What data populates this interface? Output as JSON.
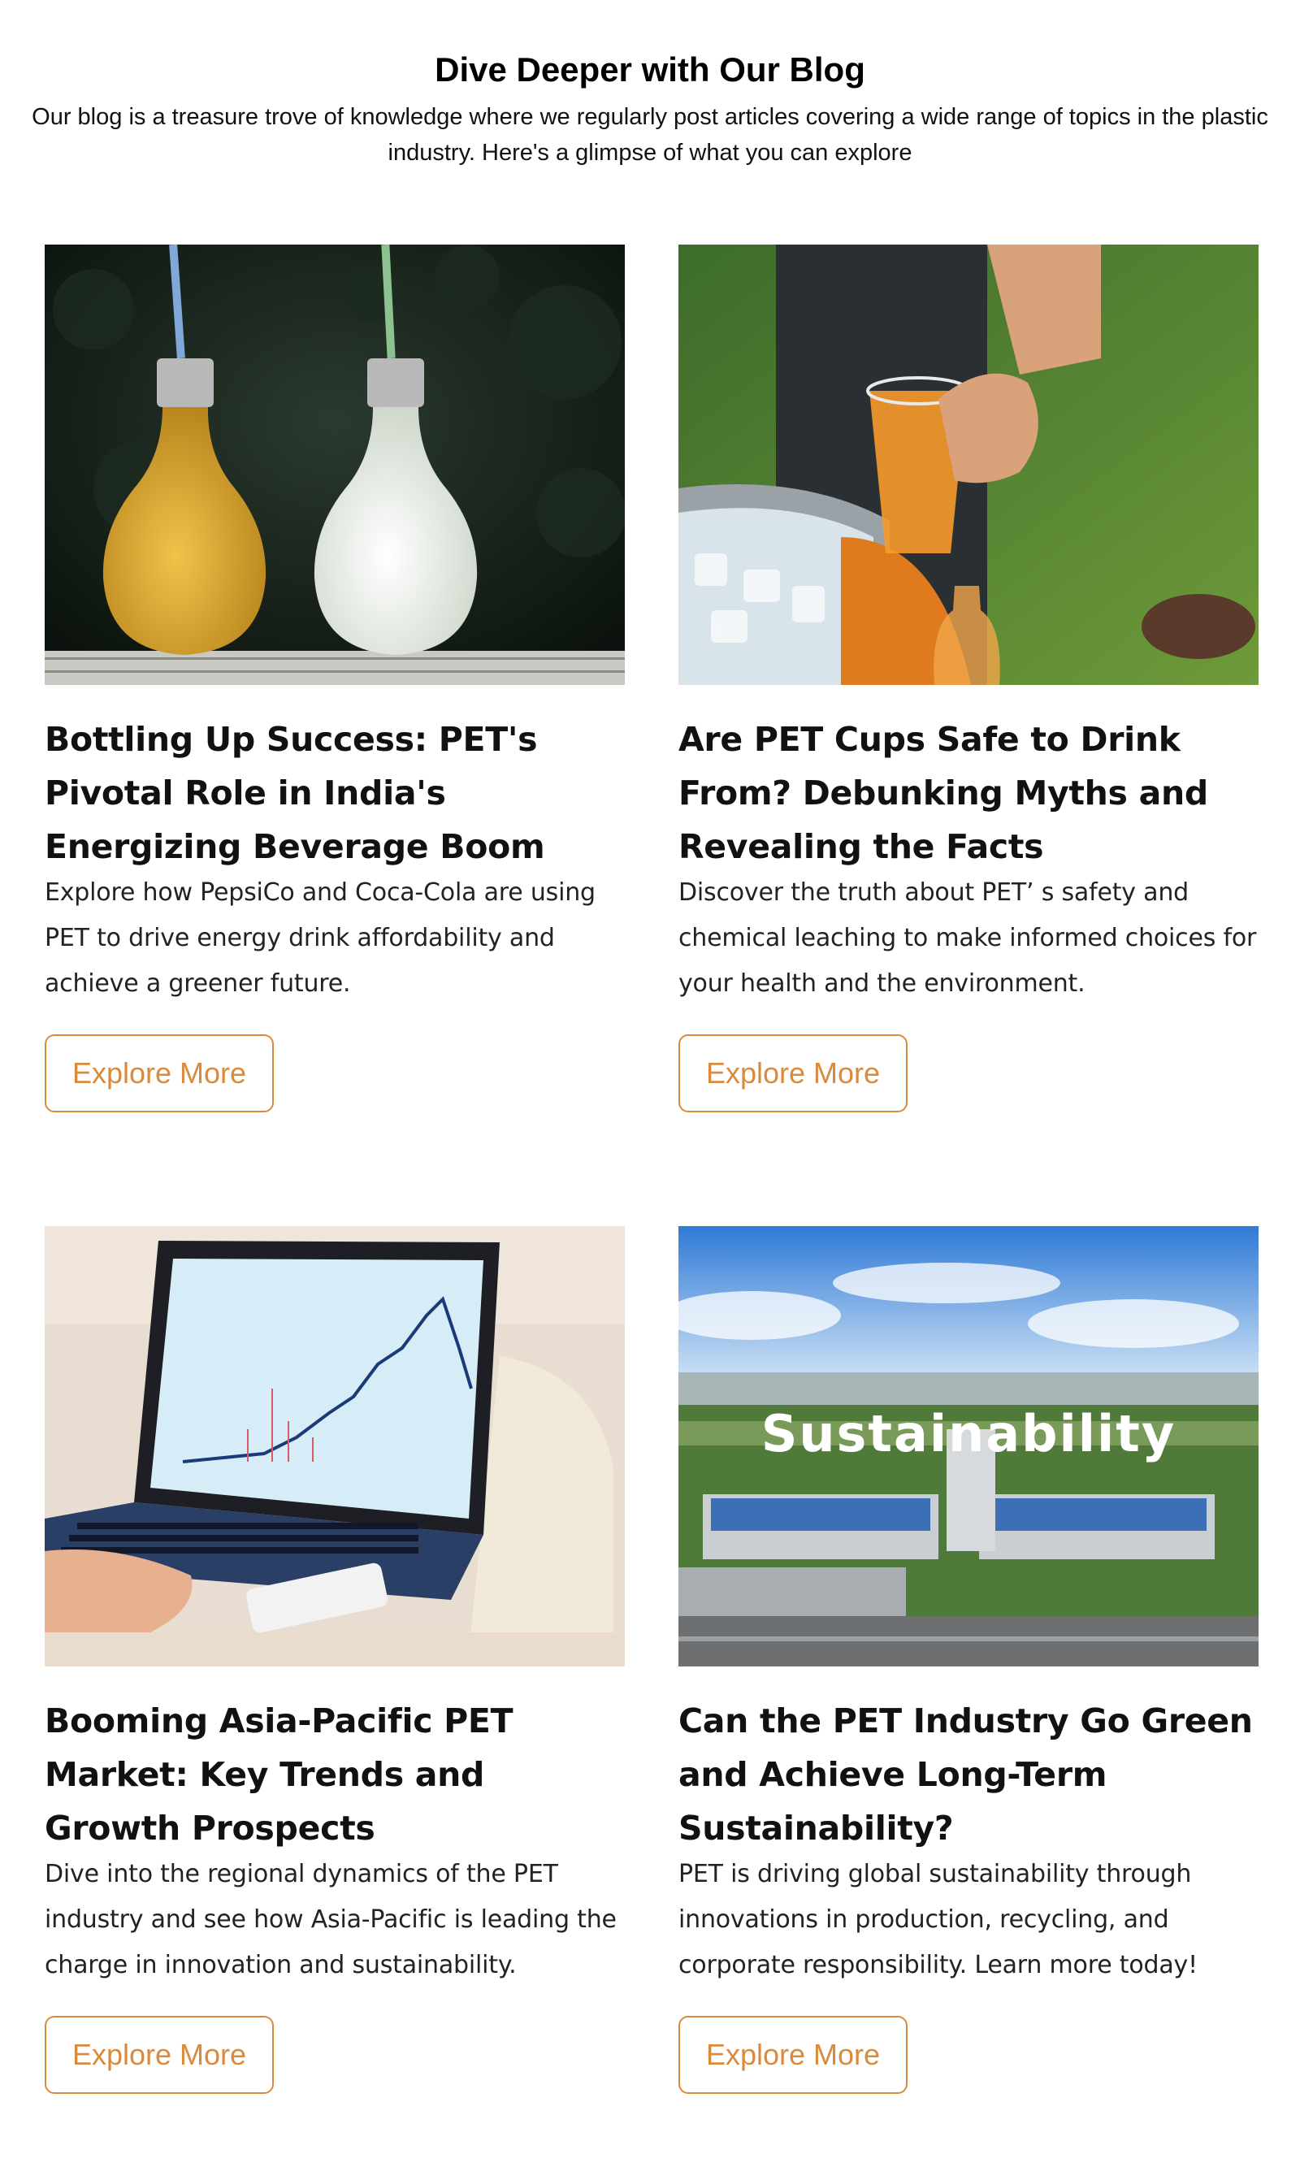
{
  "header": {
    "title": "Dive Deeper with Our Blog",
    "subtitle": "Our blog is a treasure trove of knowledge where we regularly post articles covering a wide range of topics in the plastic industry. Here's a glimpse of what you can explore"
  },
  "colors": {
    "accent": "#d98a3d",
    "text": "#111111",
    "background": "#ffffff"
  },
  "cards": [
    {
      "image": "bulb-shaped-juice-bottles-photo",
      "title": "Bottling Up Success: PET's Pivotal Role in India's Energizing Beverage Boom",
      "description": "Explore how PepsiCo and Coca-Cola are using PET to drive energy drink affordability and achieve a greener future.",
      "button": "Explore More"
    },
    {
      "image": "hand-holding-pet-cup-photo",
      "title": "Are PET Cups Safe to Drink From? Debunking Myths and Revealing the Facts",
      "description": "Discover the truth about PET’ s safety and chemical leaching to make informed choices for your health and the environment.",
      "button": "Explore More"
    },
    {
      "image": "laptop-market-chart-photo",
      "title": "Booming Asia-Pacific PET Market: Key Trends and Growth Prospects",
      "description": "Dive into the regional dynamics of the PET industry and see how Asia-Pacific is leading the charge in innovation and sustainability.",
      "button": "Explore More"
    },
    {
      "image": "aerial-factory-sustainability-photo",
      "image_caption": "Sustainability",
      "title": "Can the PET Industry Go Green and Achieve Long-Term Sustainability?",
      "description": "PET is driving global sustainability through innovations in production, recycling, and corporate responsibility. Learn more today!",
      "button": "Explore More"
    }
  ]
}
